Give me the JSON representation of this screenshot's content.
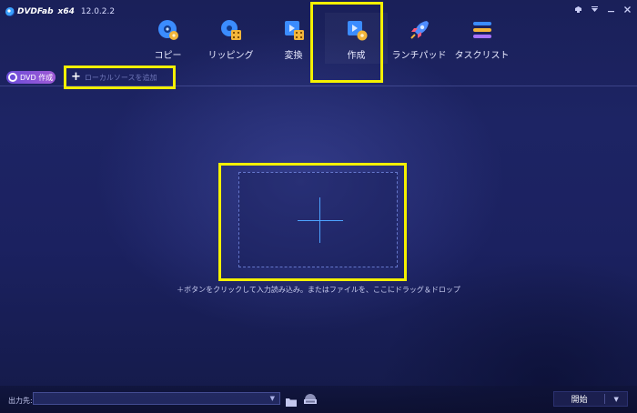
{
  "app": {
    "brand": "DVDFab",
    "edition": "x64",
    "version": "12.0.2.2"
  },
  "window_controls": [
    "minimize-to-tray-icon",
    "menu-icon",
    "minimize-icon",
    "close-icon"
  ],
  "nav": {
    "items": [
      {
        "label": "コピー",
        "icon": "copy-disc-icon"
      },
      {
        "label": "リッピング",
        "icon": "ripper-icon"
      },
      {
        "label": "変換",
        "icon": "converter-icon"
      },
      {
        "label": "作成",
        "icon": "creator-icon",
        "active": true
      },
      {
        "label": "ランチパッド",
        "icon": "launchpad-rocket-icon"
      },
      {
        "label": "タスクリスト",
        "icon": "task-list-icon"
      }
    ]
  },
  "toolbar": {
    "mode_label": "DVD 作成",
    "add_source_label": "ローカルソースを追加"
  },
  "drop_zone": {
    "hint": "＋ボタンをクリックして入力読み込み。またはファイルを、ここにドラッグ＆ドロップ"
  },
  "bottom": {
    "output_label": "出力先:",
    "output_value": "",
    "start_label": "開始"
  },
  "colors": {
    "highlight": "#f4f000",
    "accent_blue": "#4da3ff",
    "mode_chip": "#8a55d8",
    "background": "#1d2464"
  }
}
